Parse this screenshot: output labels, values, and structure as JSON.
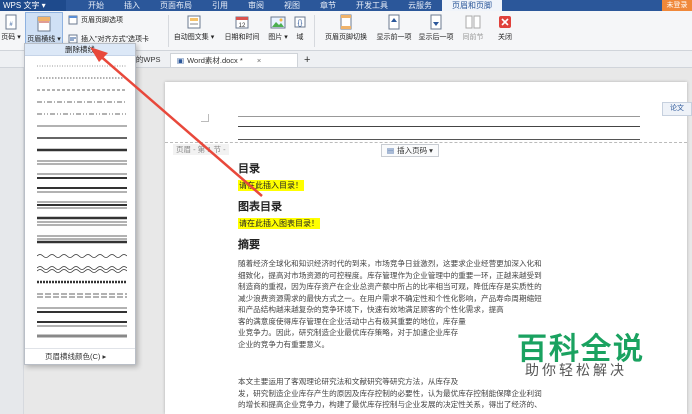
{
  "titlebar": {
    "app_name": "WPS 文字 ▾",
    "tabs": [
      "开始",
      "插入",
      "页面布局",
      "引用",
      "审阅",
      "视图",
      "章节",
      "开发工具",
      "云服务",
      "页眉和页脚"
    ],
    "active_tab": "页眉和页脚",
    "user_label": "未登录"
  },
  "ribbon": {
    "page_code": "页码 ▾",
    "header_line": "页眉横线 ▾",
    "header_footer_options": "页眉页脚选项",
    "insert_align_tab": "插入\"对齐方式\"选项卡",
    "auto_text": "自动图文集 ▾",
    "date_time": "日期和时间",
    "picture": "图片 ▾",
    "field": "域",
    "switch_hf": "页眉页脚切换",
    "show_prev": "显示前一项",
    "show_next": "显示后一项",
    "same_prev": "同前节",
    "close": "关闭"
  },
  "doctabs": {
    "tab1": "我的WPS",
    "tab2": "Word素材.docx *",
    "add": "+",
    "close": "×"
  },
  "dropdown": {
    "header": "删除横线",
    "footer": "页眉横线颜色(C) ▸"
  },
  "document": {
    "header_label": "页眉 - 第 1 节 -",
    "insert_page_number": "插入页码 ▾",
    "toc_title": "目录",
    "toc_placeholder": "请在此插入目录！",
    "fig_title": "图表目录",
    "fig_placeholder": "请在此插入图表目录！",
    "abstract_title": "摘要",
    "abstract_lines": [
      "随着经济全球化和知识经济时代的到来，市场竞争日益激烈，这要求企业经营更加深入化和",
      "细致化，提高对市场资源的可控程度。库存管理作为企业管理中的重要一环，正越来越受到",
      "制造商的重视，因为库存资产在企业总资产额中所占的比率相当可观，降低库存是实质性的",
      "减少浪费资源需求的最快方式之一。在用户需求不确定性和个性化影响，产品寿命周期缩短",
      "和产品结构越来越复杂的竞争环境下，快速有效地满足顾客的个性化需求，提高",
      "客的满意度使得库存管理在企业活动中占有极其重要的地位，库存量",
      "业竞争力。因此，研究制造企业最优库存策略，对于加速企业库存",
      "企业的竞争力有重要意义。"
    ],
    "body_lines": [
      "本文主要运用了客观理论研究法和文献研究等研究方法，从库存及",
      "发，研究制造企业库存产生的原因及库存控制的必要性，认为最优库存控制能保障企业利润",
      "的增长和提高企业竞争力，构建了最优库存控制与企业发展的决定性关系，得出了经济的、"
    ]
  },
  "side_button": "论文",
  "watermark": {
    "big": "百科全说",
    "small": "助你轻松解决"
  },
  "colors": {
    "accent": "#2b579a",
    "highlight": "#ffff00",
    "arrow": "#e8483b",
    "watermark": "#1aa260"
  }
}
